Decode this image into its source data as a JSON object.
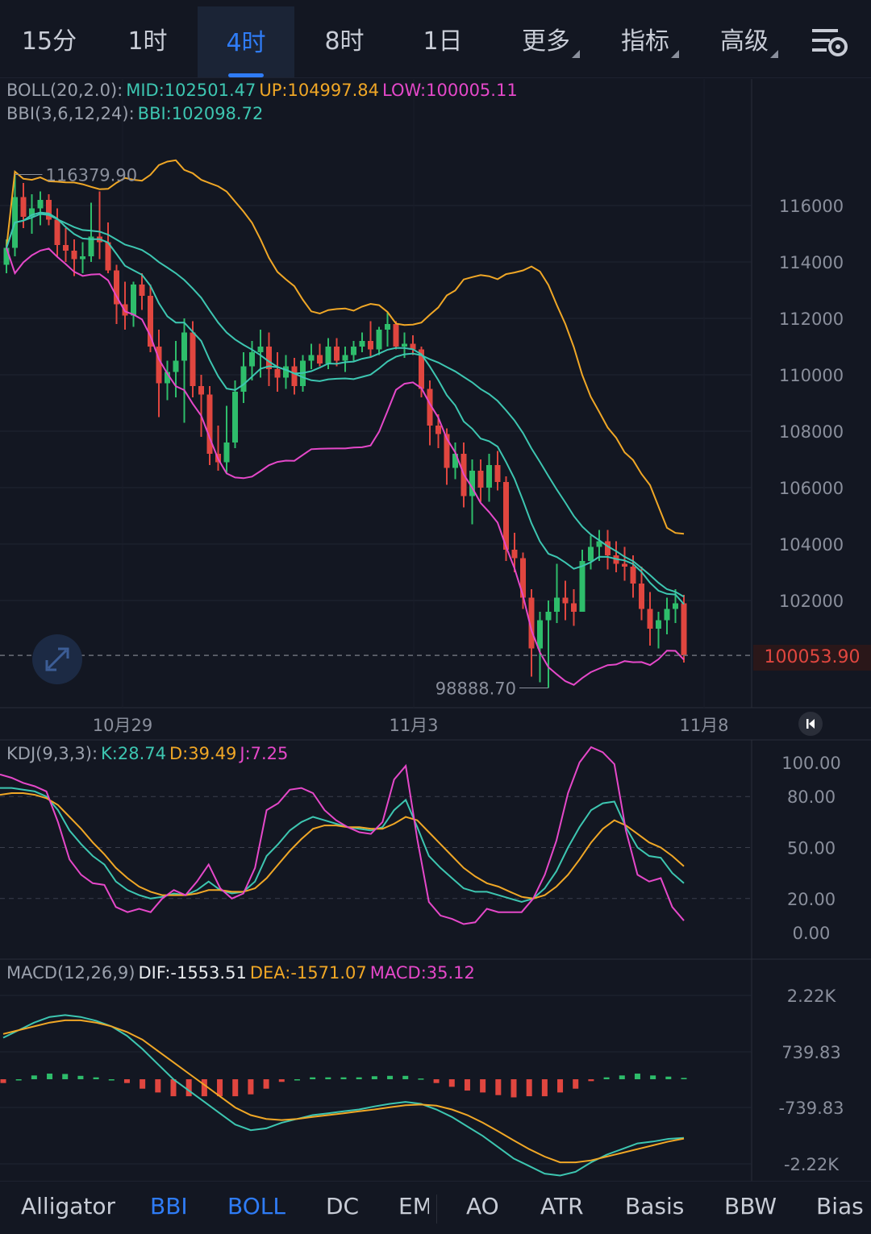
{
  "timeframes": [
    {
      "label": "15分",
      "active": false
    },
    {
      "label": "1时",
      "active": false
    },
    {
      "label": "4时",
      "active": true
    },
    {
      "label": "8时",
      "active": false
    },
    {
      "label": "1日",
      "active": false
    },
    {
      "label": "更多",
      "active": false
    },
    {
      "label": "指标",
      "active": false
    },
    {
      "label": "高级",
      "active": false
    }
  ],
  "settings_icon": "chart-settings-icon",
  "main": {
    "boll_label": "BOLL(20,2.0):",
    "boll_mid": "MID:102501.47",
    "boll_up": "UP:104997.84",
    "boll_low": "LOW:100005.11",
    "bbi_label": "BBI(3,6,12,24):",
    "bbi_value": "BBI:102098.72",
    "high_label": "116379.90",
    "low_label": "98888.70",
    "last_price": "100053.90",
    "y_ticks": [
      "116000",
      "114000",
      "112000",
      "110000",
      "108000",
      "106000",
      "104000",
      "102000"
    ],
    "y_tick_values": [
      116000,
      114000,
      112000,
      110000,
      108000,
      106000,
      104000,
      102000
    ],
    "dates": [
      "10月29",
      "11月3",
      "11月8"
    ],
    "expand_icon": "expand-arrows-icon",
    "home_icon": "scroll-to-latest-icon"
  },
  "kdj": {
    "label": "KDJ(9,3,3):",
    "k": "K:28.74",
    "d": "D:39.49",
    "j": "J:7.25",
    "y_ticks": [
      "100.00",
      "80.00",
      "50.00",
      "20.00",
      "0.00"
    ]
  },
  "macd": {
    "label": "MACD(12,26,9)",
    "dif": "DIF:-1553.51",
    "dea": "DEA:-1571.07",
    "macd": "MACD:35.12",
    "y_ticks": [
      "2.22K",
      "739.83",
      "-739.83",
      "-2.22K"
    ]
  },
  "indicators": [
    {
      "label": "Alligator",
      "active": false
    },
    {
      "label": "BBI",
      "active": true
    },
    {
      "label": "BOLL",
      "active": true
    },
    {
      "label": "DC",
      "active": false
    },
    {
      "label": "EM",
      "active": false
    },
    {
      "label": "AO",
      "active": false
    },
    {
      "label": "ATR",
      "active": false
    },
    {
      "label": "Basis",
      "active": false
    },
    {
      "label": "BBW",
      "active": false
    },
    {
      "label": "Bias",
      "active": false
    }
  ],
  "colors": {
    "background": "#131722",
    "up": "#2ebd6b",
    "down": "#e0463f",
    "accent": "#2f7cf6",
    "boll_mid": "#3dc6b1",
    "boll_up": "#f0a726",
    "boll_low": "#e548c9",
    "bbi": "#3dc6b1"
  },
  "chart_data": [
    {
      "type": "candlestick",
      "title": "",
      "ylim": [
        98888.7,
        116379.9
      ],
      "y_ticks": [
        102000,
        104000,
        106000,
        108000,
        110000,
        112000,
        114000,
        116000
      ],
      "x_ticks": [
        "10月29",
        "11月3",
        "11月8"
      ],
      "last_price": 100053.9,
      "high": 116379.9,
      "low": 98888.7,
      "candles": [
        [
          113900,
          114800,
          113600,
          114500
        ],
        [
          114500,
          117100,
          114200,
          116300
        ],
        [
          116300,
          116800,
          115200,
          115600
        ],
        [
          115600,
          116400,
          115000,
          115900
        ],
        [
          115900,
          116500,
          115300,
          116200
        ],
        [
          116200,
          116400,
          115300,
          115500
        ],
        [
          115500,
          115900,
          114200,
          114600
        ],
        [
          114600,
          115200,
          114000,
          114400
        ],
        [
          114400,
          114800,
          113500,
          114100
        ],
        [
          114100,
          114700,
          113600,
          114200
        ],
        [
          114200,
          116100,
          114000,
          114900
        ],
        [
          114900,
          116500,
          114100,
          114700
        ],
        [
          114700,
          115400,
          113600,
          113700
        ],
        [
          113700,
          113900,
          111800,
          112500
        ],
        [
          112500,
          113300,
          111600,
          112100
        ],
        [
          112100,
          113300,
          111700,
          113200
        ],
        [
          113200,
          113600,
          112300,
          112800
        ],
        [
          112800,
          113200,
          110800,
          111000
        ],
        [
          111000,
          111600,
          108500,
          109700
        ],
        [
          109700,
          110500,
          109100,
          110100
        ],
        [
          110100,
          111200,
          109200,
          110500
        ],
        [
          110500,
          112000,
          108300,
          111500
        ],
        [
          111500,
          111900,
          109200,
          109600
        ],
        [
          109600,
          110000,
          107800,
          109300
        ],
        [
          109300,
          109600,
          106800,
          107200
        ],
        [
          107200,
          108200,
          106600,
          106900
        ],
        [
          106900,
          108900,
          106500,
          107600
        ],
        [
          107600,
          109800,
          107400,
          109400
        ],
        [
          109400,
          110800,
          109000,
          110300
        ],
        [
          110300,
          111200,
          109800,
          110800
        ],
        [
          110800,
          111600,
          109900,
          111000
        ],
        [
          111000,
          111500,
          109600,
          110200
        ],
        [
          110200,
          110800,
          109400,
          109900
        ],
        [
          109900,
          110700,
          109500,
          110300
        ],
        [
          110300,
          110600,
          109300,
          109600
        ],
        [
          109600,
          110700,
          109400,
          110500
        ],
        [
          110500,
          111100,
          110200,
          110700
        ],
        [
          110700,
          111100,
          110300,
          110400
        ],
        [
          110400,
          111300,
          110200,
          111000
        ],
        [
          111000,
          111300,
          110300,
          110500
        ],
        [
          110500,
          111000,
          110100,
          110700
        ],
        [
          110700,
          111200,
          110500,
          111000
        ],
        [
          111000,
          111500,
          110800,
          111200
        ],
        [
          111200,
          111900,
          110600,
          110900
        ],
        [
          110900,
          111700,
          110700,
          111600
        ],
        [
          111600,
          112200,
          111000,
          111800
        ],
        [
          111800,
          111900,
          110900,
          111000
        ],
        [
          111000,
          111500,
          110600,
          111100
        ],
        [
          111100,
          111400,
          110700,
          110900
        ],
        [
          110900,
          111000,
          109200,
          109500
        ],
        [
          109500,
          109800,
          107500,
          108200
        ],
        [
          108200,
          108600,
          107400,
          107900
        ],
        [
          107900,
          108100,
          106100,
          106700
        ],
        [
          106700,
          107600,
          106300,
          107200
        ],
        [
          107200,
          107600,
          105300,
          105700
        ],
        [
          105700,
          107000,
          104700,
          106600
        ],
        [
          106600,
          107000,
          105500,
          106000
        ],
        [
          106000,
          107200,
          105500,
          106800
        ],
        [
          106800,
          107300,
          105900,
          106200
        ],
        [
          106200,
          106400,
          103400,
          103800
        ],
        [
          103800,
          104400,
          103000,
          103500
        ],
        [
          103500,
          103700,
          101700,
          102100
        ],
        [
          102100,
          102400,
          99300,
          100300
        ],
        [
          100300,
          101600,
          99100,
          101300
        ],
        [
          101300,
          102000,
          98900,
          101600
        ],
        [
          101600,
          103300,
          101200,
          102100
        ],
        [
          102100,
          102700,
          101300,
          101900
        ],
        [
          101900,
          102400,
          101100,
          101600
        ],
        [
          101600,
          103800,
          101600,
          103400
        ],
        [
          103400,
          104300,
          103100,
          103900
        ],
        [
          103900,
          104500,
          103400,
          104100
        ],
        [
          104100,
          104500,
          103100,
          103600
        ],
        [
          103600,
          104100,
          103000,
          103300
        ],
        [
          103300,
          103900,
          102700,
          103200
        ],
        [
          103200,
          103600,
          102100,
          102600
        ],
        [
          102600,
          103200,
          101300,
          101700
        ],
        [
          101700,
          102300,
          100400,
          101000
        ],
        [
          101000,
          101600,
          100300,
          101300
        ],
        [
          101300,
          102100,
          100800,
          101700
        ],
        [
          101700,
          102400,
          101200,
          101900
        ],
        [
          101900,
          102200,
          99800,
          100054
        ]
      ]
    },
    {
      "type": "line",
      "title": "",
      "ylim": [
        0,
        100
      ],
      "y_ticks": [
        0,
        20,
        50,
        80,
        100
      ],
      "series": [
        {
          "name": "K",
          "values": [
            85,
            85,
            84,
            83,
            80,
            72,
            60,
            52,
            45,
            40,
            30,
            25,
            22,
            20,
            21,
            23,
            22,
            25,
            30,
            25,
            23,
            24,
            30,
            45,
            52,
            60,
            65,
            68,
            66,
            64,
            62,
            61,
            60,
            62,
            72,
            78,
            62,
            45,
            38,
            32,
            26,
            24,
            24,
            22,
            20,
            18,
            20,
            26,
            36,
            50,
            62,
            72,
            76,
            77,
            62,
            50,
            45,
            44,
            35,
            29
          ]
        },
        {
          "name": "D",
          "values": [
            81,
            82,
            82,
            81,
            79,
            75,
            68,
            61,
            53,
            46,
            38,
            32,
            27,
            24,
            22,
            22,
            22,
            23,
            25,
            25,
            24,
            24,
            26,
            32,
            40,
            48,
            55,
            61,
            63,
            63,
            62,
            62,
            61,
            61,
            64,
            68,
            66,
            59,
            52,
            45,
            38,
            33,
            29,
            27,
            24,
            21,
            20,
            22,
            27,
            34,
            43,
            53,
            61,
            66,
            63,
            58,
            53,
            50,
            45,
            39
          ]
        },
        {
          "name": "J",
          "values": [
            93,
            91,
            88,
            86,
            83,
            65,
            43,
            34,
            29,
            28,
            15,
            12,
            14,
            12,
            20,
            25,
            22,
            30,
            40,
            26,
            20,
            23,
            38,
            72,
            76,
            84,
            85,
            82,
            72,
            66,
            62,
            59,
            58,
            65,
            90,
            98,
            55,
            18,
            10,
            8,
            5,
            6,
            14,
            12,
            12,
            12,
            20,
            34,
            54,
            82,
            100,
            109,
            106,
            99,
            60,
            34,
            30,
            32,
            15,
            7
          ]
        }
      ]
    },
    {
      "type": "bar",
      "title": "",
      "y_ticks": [
        2220,
        739.83,
        -739.83,
        -2220
      ],
      "series": [
        {
          "name": "DIF",
          "values": [
            1100,
            1300,
            1500,
            1650,
            1700,
            1650,
            1550,
            1400,
            1150,
            800,
            400,
            0,
            -300,
            -600,
            -900,
            -1200,
            -1350,
            -1300,
            -1150,
            -1050,
            -950,
            -900,
            -850,
            -800,
            -720,
            -650,
            -600,
            -650,
            -800,
            -1000,
            -1250,
            -1500,
            -1800,
            -2100,
            -2300,
            -2500,
            -2550,
            -2450,
            -2200,
            -2000,
            -1850,
            -1700,
            -1650,
            -1580,
            -1553.51
          ]
        },
        {
          "name": "DEA",
          "values": [
            1200,
            1300,
            1400,
            1500,
            1560,
            1560,
            1500,
            1400,
            1250,
            1050,
            750,
            450,
            150,
            -150,
            -450,
            -750,
            -950,
            -1050,
            -1080,
            -1050,
            -1000,
            -950,
            -900,
            -850,
            -800,
            -740,
            -690,
            -670,
            -700,
            -800,
            -950,
            -1150,
            -1380,
            -1620,
            -1850,
            -2050,
            -2200,
            -2200,
            -2150,
            -2050,
            -1950,
            -1850,
            -1750,
            -1650,
            -1571.07
          ]
        },
        {
          "name": "MACD",
          "values": [
            -100,
            0,
            100,
            150,
            140,
            90,
            50,
            0,
            -100,
            -250,
            -350,
            -450,
            -450,
            -450,
            -450,
            -450,
            -400,
            -250,
            -70,
            0,
            50,
            50,
            50,
            50,
            80,
            90,
            90,
            20,
            -100,
            -200,
            -300,
            -350,
            -420,
            -480,
            -450,
            -450,
            -350,
            -250,
            -50,
            50,
            100,
            150,
            100,
            70,
            35.12
          ]
        }
      ]
    }
  ]
}
